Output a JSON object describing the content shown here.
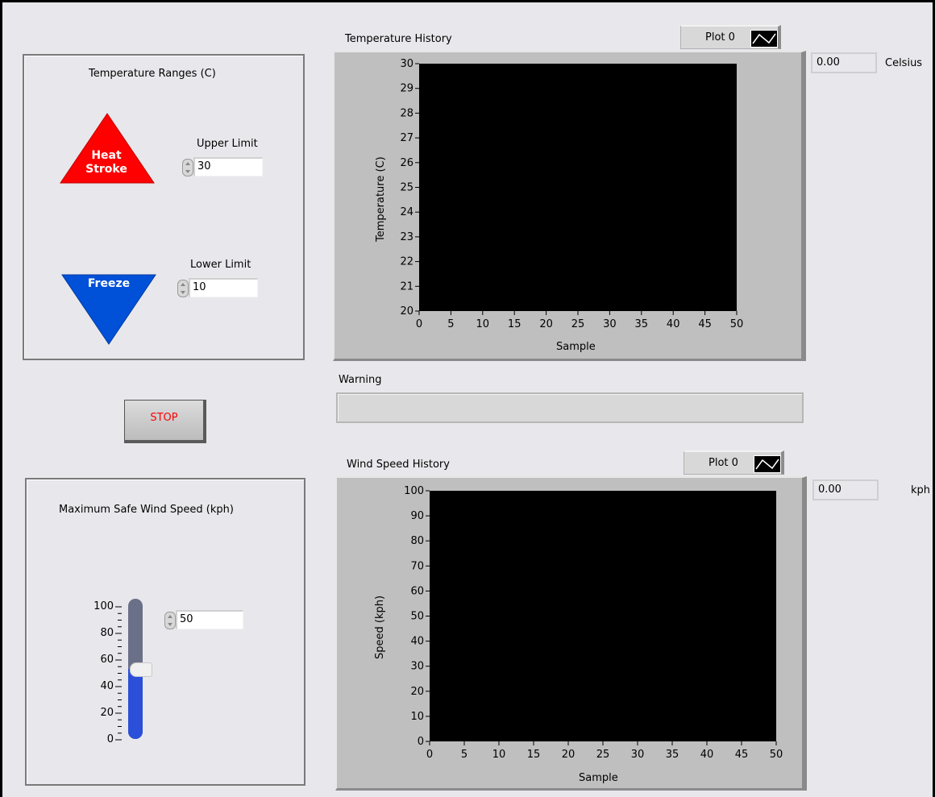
{
  "temperature_ranges": {
    "title": "Temperature Ranges (C)",
    "heat_label_1": "Heat",
    "heat_label_2": "Stroke",
    "freeze_label": "Freeze",
    "upper_limit_label": "Upper Limit",
    "upper_limit_value": "30",
    "lower_limit_label": "Lower Limit",
    "lower_limit_value": "10",
    "heat_color": "#ff0000",
    "freeze_color": "#0050d8"
  },
  "stop_button": {
    "label": "STOP",
    "color": "#ff0000"
  },
  "wind": {
    "title": "Maximum Safe Wind Speed (kph)",
    "value": "50",
    "slider_level": 50,
    "scale": [
      "100",
      "80",
      "60",
      "40",
      "20",
      "0"
    ],
    "fill_color": "#2b4fd8"
  },
  "temp_chart": {
    "title": "Temperature History",
    "legend": "Plot 0",
    "indicator_value": "0.00",
    "indicator_unit": "Celsius",
    "ylabel": "Temperature (C)",
    "xlabel": "Sample",
    "yticks": [
      "30",
      "29",
      "28",
      "27",
      "26",
      "25",
      "24",
      "23",
      "22",
      "21",
      "20"
    ],
    "xticks": [
      "0",
      "5",
      "10",
      "15",
      "20",
      "25",
      "30",
      "35",
      "40",
      "45",
      "50"
    ]
  },
  "warning": {
    "label": "Warning",
    "text": ""
  },
  "wind_chart": {
    "title": "Wind Speed History",
    "legend": "Plot 0",
    "indicator_value": "0.00",
    "indicator_unit": "kph",
    "ylabel": "Speed (kph)",
    "xlabel": "Sample",
    "yticks": [
      "100",
      "90",
      "80",
      "70",
      "60",
      "50",
      "40",
      "30",
      "20",
      "10",
      "0"
    ],
    "xticks": [
      "0",
      "5",
      "10",
      "15",
      "20",
      "25",
      "30",
      "35",
      "40",
      "45",
      "50"
    ]
  },
  "chart_data": [
    {
      "type": "line",
      "title": "Temperature History",
      "xlabel": "Sample",
      "ylabel": "Temperature (C)",
      "xlim": [
        0,
        50
      ],
      "ylim": [
        20,
        30
      ],
      "series": [
        {
          "name": "Plot 0",
          "x": [],
          "y": []
        }
      ],
      "grid": false,
      "legend": "top-right"
    },
    {
      "type": "line",
      "title": "Wind Speed History",
      "xlabel": "Sample",
      "ylabel": "Speed (kph)",
      "xlim": [
        0,
        50
      ],
      "ylim": [
        0,
        100
      ],
      "series": [
        {
          "name": "Plot 0",
          "x": [],
          "y": []
        }
      ],
      "grid": false,
      "legend": "top-right"
    }
  ]
}
